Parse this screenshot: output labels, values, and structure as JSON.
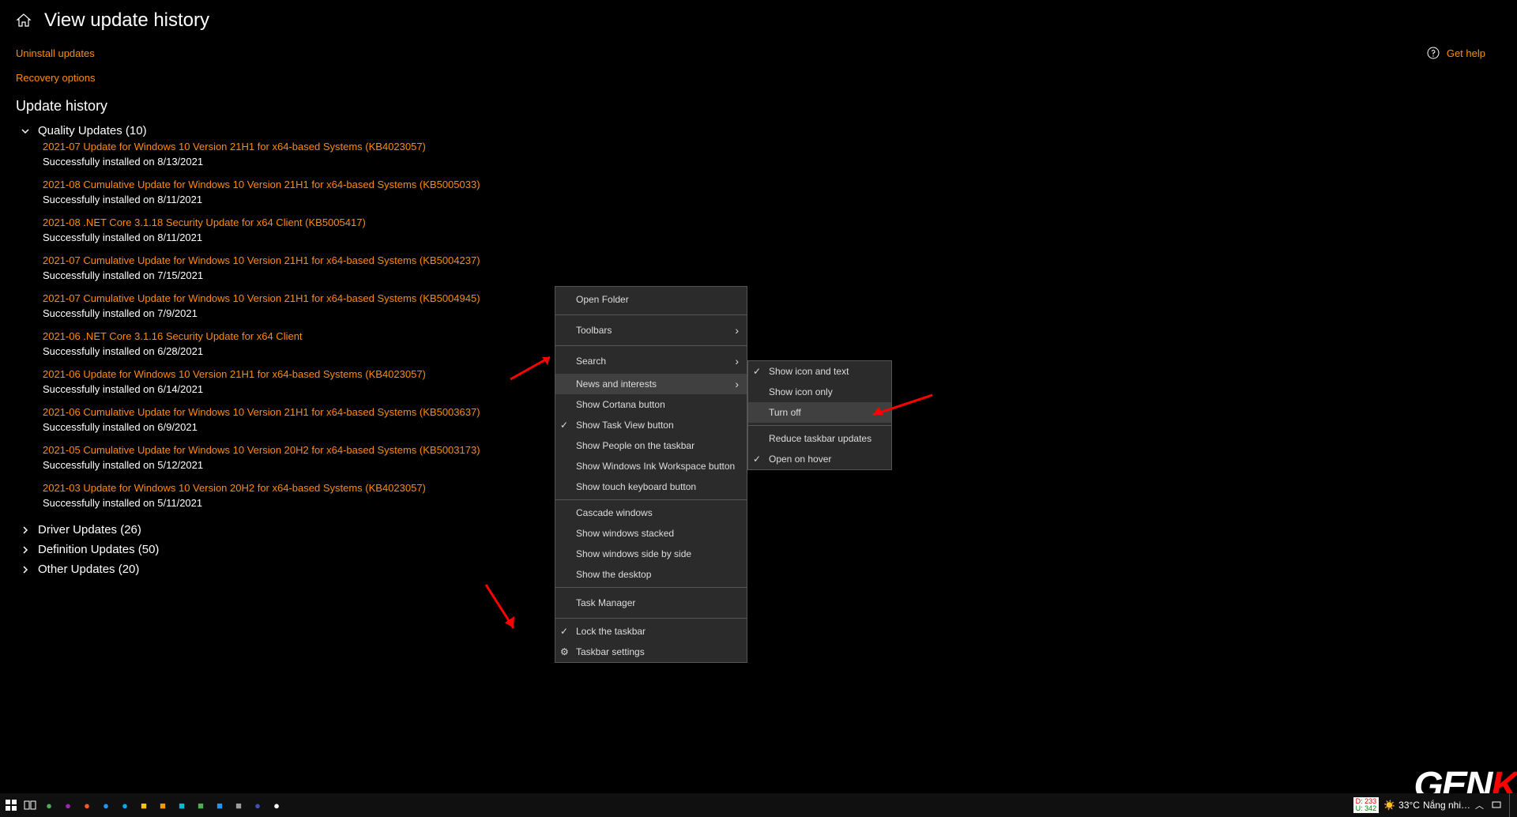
{
  "header": {
    "title": "View update history"
  },
  "links": {
    "uninstall": "Uninstall updates",
    "recovery": "Recovery options",
    "gethelp": "Get help"
  },
  "section": {
    "title": "Update history"
  },
  "groups": {
    "quality": "Quality Updates (10)",
    "driver": "Driver Updates (26)",
    "definition": "Definition Updates (50)",
    "other": "Other Updates (20)"
  },
  "updates": [
    {
      "title": "2021-07 Update for Windows 10 Version 21H1 for x64-based Systems (KB4023057)",
      "status": "Successfully installed on 8/13/2021"
    },
    {
      "title": "2021-08 Cumulative Update for Windows 10 Version 21H1 for x64-based Systems (KB5005033)",
      "status": "Successfully installed on 8/11/2021"
    },
    {
      "title": "2021-08 .NET Core 3.1.18 Security Update for x64 Client (KB5005417)",
      "status": "Successfully installed on 8/11/2021"
    },
    {
      "title": "2021-07 Cumulative Update for Windows 10 Version 21H1 for x64-based Systems (KB5004237)",
      "status": "Successfully installed on 7/15/2021"
    },
    {
      "title": "2021-07 Cumulative Update for Windows 10 Version 21H1 for x64-based Systems (KB5004945)",
      "status": "Successfully installed on 7/9/2021"
    },
    {
      "title": "2021-06 .NET Core 3.1.16 Security Update for x64 Client",
      "status": "Successfully installed on 6/28/2021"
    },
    {
      "title": "2021-06 Update for Windows 10 Version 21H1 for x64-based Systems (KB4023057)",
      "status": "Successfully installed on 6/14/2021"
    },
    {
      "title": "2021-06 Cumulative Update for Windows 10 Version 21H1 for x64-based Systems (KB5003637)",
      "status": "Successfully installed on 6/9/2021"
    },
    {
      "title": "2021-05 Cumulative Update for Windows 10 Version 20H2 for x64-based Systems (KB5003173)",
      "status": "Successfully installed on 5/12/2021"
    },
    {
      "title": "2021-03 Update for Windows 10 Version 20H2 for x64-based Systems (KB4023057)",
      "status": "Successfully installed on 5/11/2021"
    }
  ],
  "context_menu": {
    "open_folder": "Open Folder",
    "toolbars": "Toolbars",
    "search": "Search",
    "news": "News and interests",
    "cortana": "Show Cortana button",
    "taskview": "Show Task View button",
    "people": "Show People on the taskbar",
    "ink": "Show Windows Ink Workspace button",
    "touch": "Show touch keyboard button",
    "cascade": "Cascade windows",
    "stacked": "Show windows stacked",
    "sidebyside": "Show windows side by side",
    "desktop": "Show the desktop",
    "taskmgr": "Task Manager",
    "lock": "Lock the taskbar",
    "settings": "Taskbar settings"
  },
  "submenu": {
    "icontext": "Show icon and text",
    "icononly": "Show icon only",
    "turnoff": "Turn off",
    "reduce": "Reduce taskbar updates",
    "hover": "Open on hover"
  },
  "taskbar": {
    "badge_d": "D: 233",
    "badge_u": "U: 342",
    "weather_temp": "33°C",
    "weather_text": "Nắng nhi…"
  },
  "logo": {
    "gen": "GEN",
    "k": "K"
  }
}
